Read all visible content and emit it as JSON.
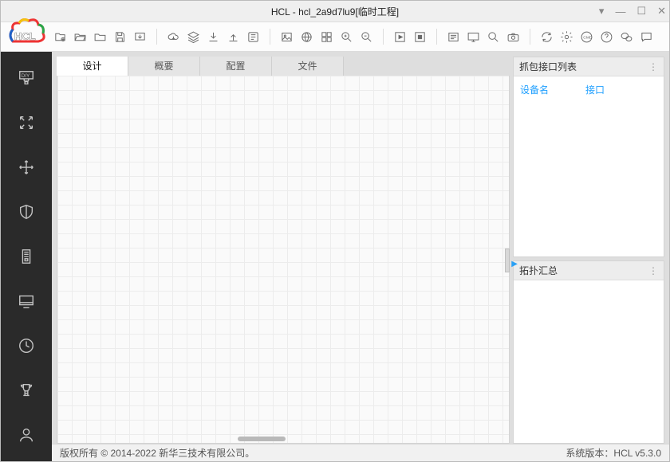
{
  "window": {
    "title": "HCL - hcl_2a9d7lu9[临时工程]"
  },
  "tabs": {
    "design": "设计",
    "overview": "概要",
    "config": "配置",
    "file": "文件"
  },
  "panels": {
    "capture": {
      "title": "抓包接口列表",
      "col_device": "设备名",
      "col_iface": "接口"
    },
    "topo": {
      "title": "拓扑汇总"
    }
  },
  "statusbar": {
    "copyright": "版权所有 © 2014-2022 新华三技术有限公司。",
    "version": "系统版本：HCL v5.3.0"
  },
  "sidebar": {
    "diy": "DIY"
  }
}
